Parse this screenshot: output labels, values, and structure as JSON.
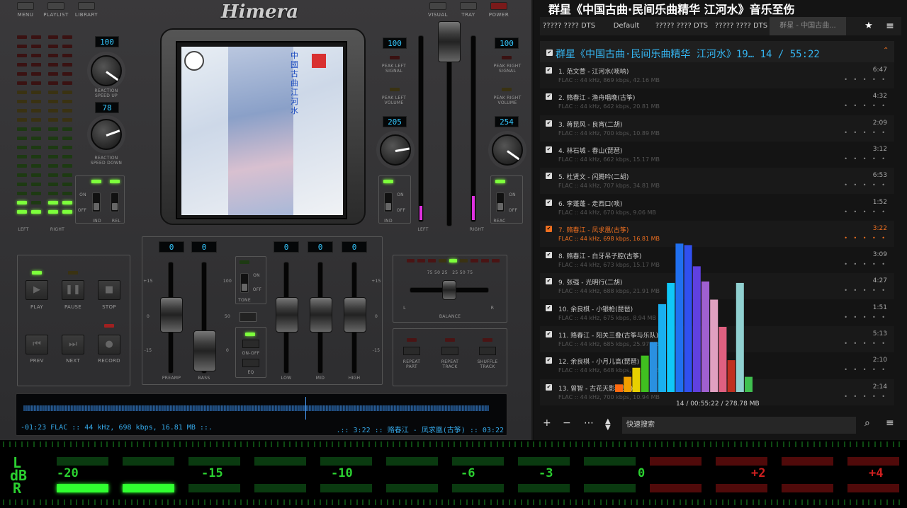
{
  "player": {
    "logo": "Himera",
    "top_left_labels": [
      "MENU",
      "PLAYLIST",
      "LIBRARY"
    ],
    "top_right_labels": [
      "VISUAL",
      "TRAY",
      "POWER"
    ],
    "lcd": {
      "speed_up": "100",
      "speed_down": "78",
      "left_peak": "100",
      "right_peak": "100",
      "left_vol": "205",
      "right_vol": "254",
      "preamp": "0",
      "bass": "0",
      "low": "0",
      "mid": "0",
      "high": "0"
    },
    "labels": {
      "reaction_up": "REACTION SPEED UP",
      "reaction_down": "REACTION SPEED DOWN",
      "peak_left_signal": "PEAK LEFT SIGNAL",
      "peak_left_volume": "PEAK LEFT VOLUME",
      "peak_right_signal": "PEAK RIGHT SIGNAL",
      "peak_right_volume": "PEAK RIGHT VOLUME",
      "left": "LEFT",
      "right": "RIGHT",
      "ind": "IND",
      "rel": "REL",
      "reac": "REAC",
      "on": "ON",
      "off": "OFF",
      "tone": "TONE",
      "on_off": "ON-OFF",
      "eq": "EQ",
      "balance": "BALANCE",
      "preamp": "PREAMP",
      "bass": "BASS",
      "low": "LOW",
      "mid": "MID",
      "high": "HIGH",
      "repeat_part": "REPEAT PART",
      "repeat_track": "REPEAT TRACK",
      "shuffle_track": "SHUFFLE TRACK"
    },
    "transport": {
      "play": "PLAY",
      "pause": "PAUSE",
      "stop": "STOP",
      "prev": "PREV",
      "next": "NEXT",
      "record": "RECORD"
    },
    "eq_scale": {
      "p15": "+15",
      "z": "0",
      "m15": "-15",
      "t100": "100",
      "t50": "50",
      "t0": "0"
    },
    "balance_scale": "75 50 25   25 50 75",
    "status_left": "-01:23 FLAC :: 44 kHz, 698 kbps, 16.81 MB ::.",
    "status_right": ".:: 3:22 :: 赂春江 - 凤求凰(古筝) :: 03:22",
    "cover_text": "中國古曲 江河水"
  },
  "playlist": {
    "window_title": "群星《中国古曲·民间乐曲精华 江河水》音乐至伤",
    "tabs": [
      "????? ???? DTS",
      "Default",
      "????? ???? DTS",
      "????? ???? DTS",
      "群星 - 中国古曲..."
    ],
    "header": "群星《中国古曲·民间乐曲精华 江河水》19… 14 / 55:22",
    "tracks": [
      {
        "title": "1. 范文萱 - 江河水(唢呐)",
        "meta": "FLAC :: 44 kHz, 869 kbps, 42.16 MB",
        "dur": "6:47"
      },
      {
        "title": "2. 赂春江 - 渔舟唱晚(古筝)",
        "meta": "FLAC :: 44 kHz, 642 kbps, 20.81 MB",
        "dur": "4:32"
      },
      {
        "title": "3. 蒋昆风 - 良宵(二胡)",
        "meta": "FLAC :: 44 kHz, 700 kbps, 10.89 MB",
        "dur": "2:09"
      },
      {
        "title": "4. 林石城 - 春山(琵琶)",
        "meta": "FLAC :: 44 kHz, 662 kbps, 15.17 MB",
        "dur": "3:12"
      },
      {
        "title": "5. 杜贤文 - 闪腾吟(二胡)",
        "meta": "FLAC :: 44 kHz, 707 kbps, 34.81 MB",
        "dur": "6:53"
      },
      {
        "title": "6. 李蓬蓬 - 走西口(唢)",
        "meta": "FLAC :: 44 kHz, 670 kbps, 9.06 MB",
        "dur": "1:52"
      },
      {
        "title": "7. 赂春江 - 凤求凰(古筝)",
        "meta": "FLAC :: 44 kHz, 698 kbps, 16.81 MB",
        "dur": "3:22"
      },
      {
        "title": "8. 赂春江 - 白牙吊子腔(古筝)",
        "meta": "FLAC :: 44 kHz, 673 kbps, 15.17 MB",
        "dur": "3:09"
      },
      {
        "title": "9. 张强 - 光明行(二胡)",
        "meta": "FLAC :: 44 kHz, 688 kbps, 21.91 MB",
        "dur": "4:27"
      },
      {
        "title": "10. 余良棋 - 小银枪(琵琶)",
        "meta": "FLAC :: 44 kHz, 675 kbps, 8.94 MB",
        "dur": "1:51"
      },
      {
        "title": "11. 赂春江 - 阳关三叠(古筝与乐队)",
        "meta": "FLAC :: 44 kHz, 685 kbps, 25.97 MB",
        "dur": "5:13"
      },
      {
        "title": "12. 余良棋 - 小月儿高(琵琶)",
        "meta": "FLAC :: 44 kHz, 648 kbps, 10.73 MB",
        "dur": "2:10"
      },
      {
        "title": "13. 曾智 - 古花天影(琵琶)",
        "meta": "FLAC :: 44 kHz, 700 kbps, 10.94 MB",
        "dur": "2:14"
      }
    ],
    "selected_index": 6,
    "status": "14 / 00:55:22 / 278.78 MB",
    "search_placeholder": "快速搜索",
    "dots": "• • • • •"
  },
  "meter": {
    "l": "L",
    "db": "dB",
    "r": "R",
    "scale": [
      "-20",
      "-15",
      "-10",
      "-6",
      "-3",
      "0",
      "+2",
      "+4"
    ],
    "left_level": 0.0,
    "right_level": 0.14
  },
  "spectrum": {
    "levels": [
      0.05,
      0.1,
      0.16,
      0.24,
      0.33,
      0.58,
      0.72,
      0.98,
      0.97,
      0.83,
      0.73,
      0.61,
      0.43,
      0.21,
      0.72,
      0.1
    ],
    "colors": [
      "#ff6a10",
      "#f0a000",
      "#e8d000",
      "#40c020",
      "#2a90e0",
      "#1ab0f0",
      "#10c8f8",
      "#2070f0",
      "#3050f0",
      "#6040e0",
      "#a060d0",
      "#e0a0c0",
      "#e06080",
      "#c03020",
      "#90d0d0",
      "#40c050"
    ]
  },
  "colors": {
    "accent": "#35b5f0",
    "selected": "#f07020",
    "meter_green": "#2bd030",
    "meter_red": "#d02020"
  }
}
